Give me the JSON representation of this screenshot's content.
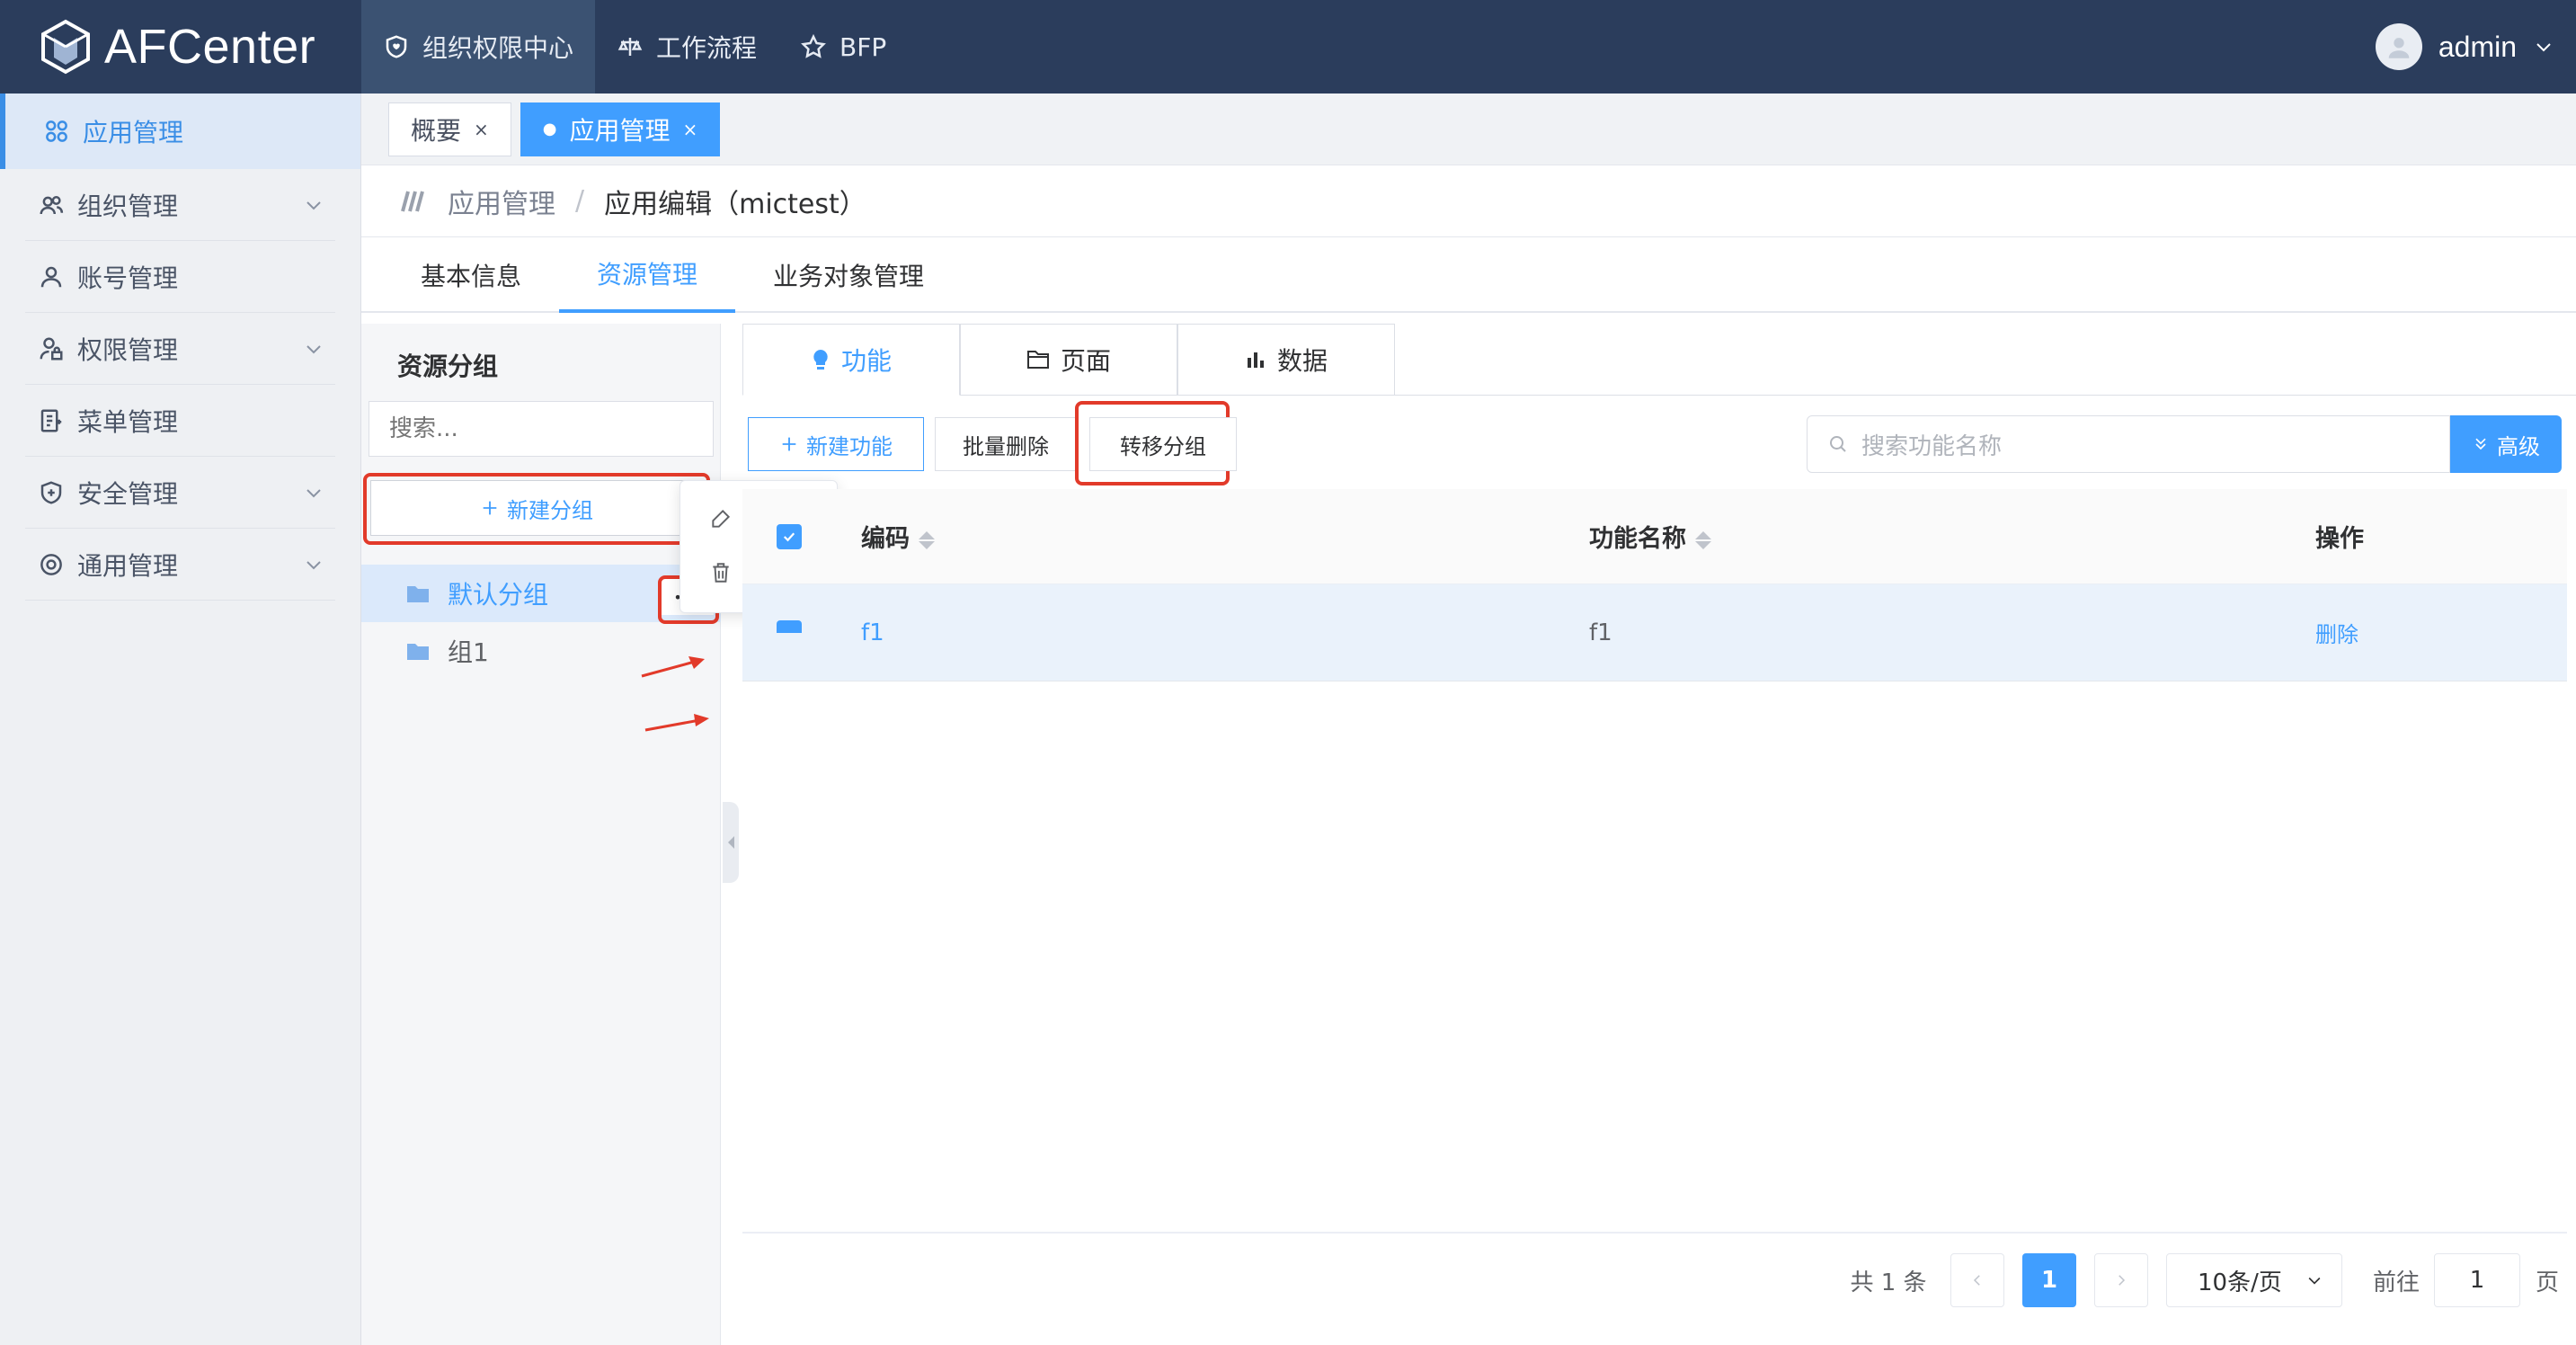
{
  "app": {
    "name": "AFCenter"
  },
  "topnav": [
    {
      "label": "组织权限中心",
      "icon": "shield-heart-icon",
      "active": true
    },
    {
      "label": "工作流程",
      "icon": "workflow-icon",
      "active": false
    },
    {
      "label": "BFP",
      "icon": "star-icon",
      "active": false
    }
  ],
  "user": {
    "name": "admin"
  },
  "sidebar": {
    "items": [
      {
        "label": "应用管理",
        "icon": "grid-icon",
        "active": true,
        "expandable": false
      },
      {
        "label": "组织管理",
        "icon": "users-icon",
        "expandable": true
      },
      {
        "label": "账号管理",
        "icon": "user-icon",
        "expandable": false
      },
      {
        "label": "权限管理",
        "icon": "user-lock-icon",
        "expandable": true
      },
      {
        "label": "菜单管理",
        "icon": "menu-doc-icon",
        "expandable": false
      },
      {
        "label": "安全管理",
        "icon": "shield-plus-icon",
        "expandable": true
      },
      {
        "label": "通用管理",
        "icon": "settings-icon",
        "expandable": true
      }
    ]
  },
  "pagetabs": [
    {
      "label": "概要",
      "close": "×",
      "active": false
    },
    {
      "label": "应用管理",
      "close": "×",
      "active": true,
      "dot": "●"
    }
  ],
  "breadcrumb": {
    "parent": "应用管理",
    "sep": "/",
    "current": "应用编辑（mictest）"
  },
  "subtabs": [
    {
      "label": "基本信息",
      "active": false
    },
    {
      "label": "资源管理",
      "active": true
    },
    {
      "label": "业务对象管理",
      "active": false
    }
  ],
  "groups": {
    "title": "资源分组",
    "search_placeholder": "搜索...",
    "new_label": "新建分组",
    "new_icon": "plus-icon",
    "items": [
      {
        "label": "默认分组",
        "selected": true
      },
      {
        "label": "组1",
        "selected": false
      }
    ],
    "more_label": "•••",
    "context_menu": [
      {
        "label": "编辑",
        "icon": "edit-icon"
      },
      {
        "label": "删除",
        "icon": "trash-icon"
      }
    ]
  },
  "resource_tabs": [
    {
      "label": "功能",
      "icon": "bulb-icon",
      "active": true
    },
    {
      "label": "页面",
      "icon": "folder-page-icon",
      "active": false
    },
    {
      "label": "数据",
      "icon": "bar-chart-icon",
      "active": false
    }
  ],
  "toolbar": {
    "new_label": "新建功能",
    "batch_delete_label": "批量删除",
    "move_group_label": "转移分组",
    "search_placeholder": "搜索功能名称",
    "advanced_label": "高级"
  },
  "table": {
    "columns": [
      "编码",
      "功能名称",
      "操作"
    ],
    "rows": [
      {
        "code": "f1",
        "name": "f1",
        "action": "删除",
        "checked": true
      }
    ]
  },
  "pagination": {
    "total_text": "共 1 条",
    "current_page": "1",
    "page_size": "10条/页",
    "goto_label": "前往",
    "goto_value": "1",
    "page_unit": "页"
  },
  "colors": {
    "primary": "#409eff",
    "topbar": "#2b3d5c",
    "highlight": "#e23a2a"
  }
}
